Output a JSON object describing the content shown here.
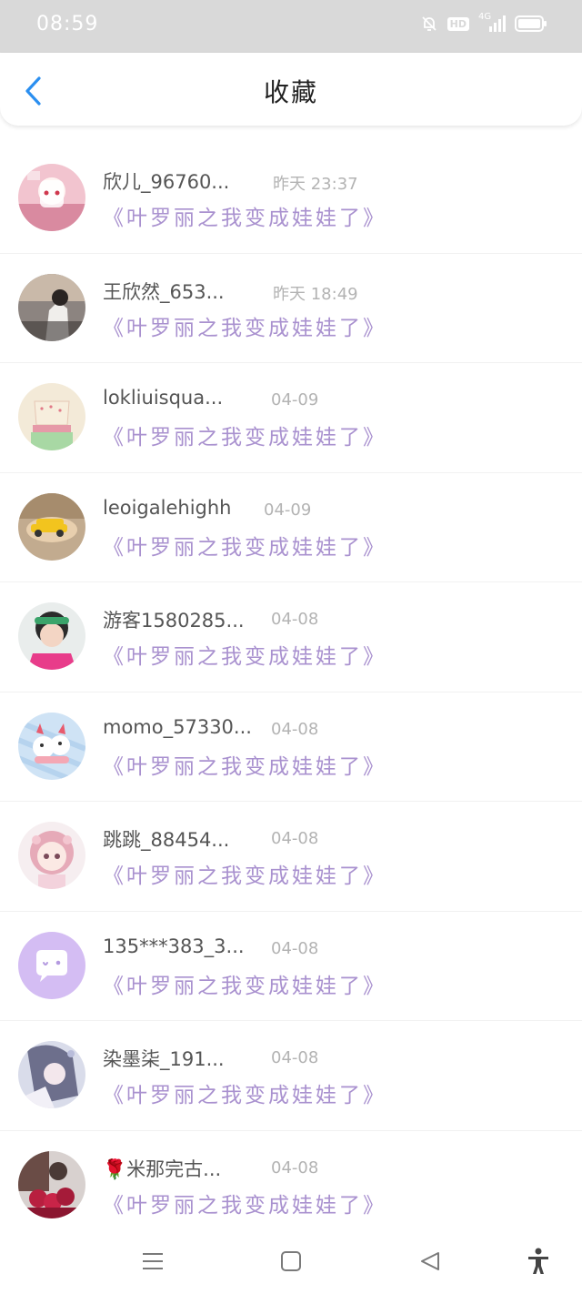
{
  "status_bar": {
    "time": "08:59",
    "hd_badge": "HD",
    "network": "4G"
  },
  "header": {
    "title": "收藏",
    "back_icon": "chevron-left-icon",
    "accent_color": "#2b8ff0"
  },
  "work_color": "#a991cf",
  "favorites": [
    {
      "user": "欣儿_96760...",
      "date": "昨天 23:37",
      "work": "《叶罗丽之我变成娃娃了》"
    },
    {
      "user": "王欣然_653...",
      "date": "昨天 18:49",
      "work": "《叶罗丽之我变成娃娃了》"
    },
    {
      "user": "lokliuisqua...",
      "date": "04-09",
      "work": "《叶罗丽之我变成娃娃了》"
    },
    {
      "user": "leoigalehighh",
      "date": "04-09",
      "work": "《叶罗丽之我变成娃娃了》"
    },
    {
      "user": "游客1580285...",
      "date": "04-08",
      "work": "《叶罗丽之我变成娃娃了》"
    },
    {
      "user": "momo_57330...",
      "date": "04-08",
      "work": "《叶罗丽之我变成娃娃了》"
    },
    {
      "user": "跳跳_88454...",
      "date": "04-08",
      "work": "《叶罗丽之我变成娃娃了》"
    },
    {
      "user": "135***383_3...",
      "date": "04-08",
      "work": "《叶罗丽之我变成娃娃了》"
    },
    {
      "user": "染墨柒_191...",
      "date": "04-08",
      "work": "《叶罗丽之我变成娃娃了》"
    },
    {
      "user": "🌹米那完古...",
      "date": "04-08",
      "work": "《叶罗丽之我变成娃娃了》"
    }
  ],
  "nav_bar": {
    "icons": [
      "menu-icon",
      "home-square-icon",
      "back-triangle-icon",
      "accessibility-icon"
    ]
  }
}
